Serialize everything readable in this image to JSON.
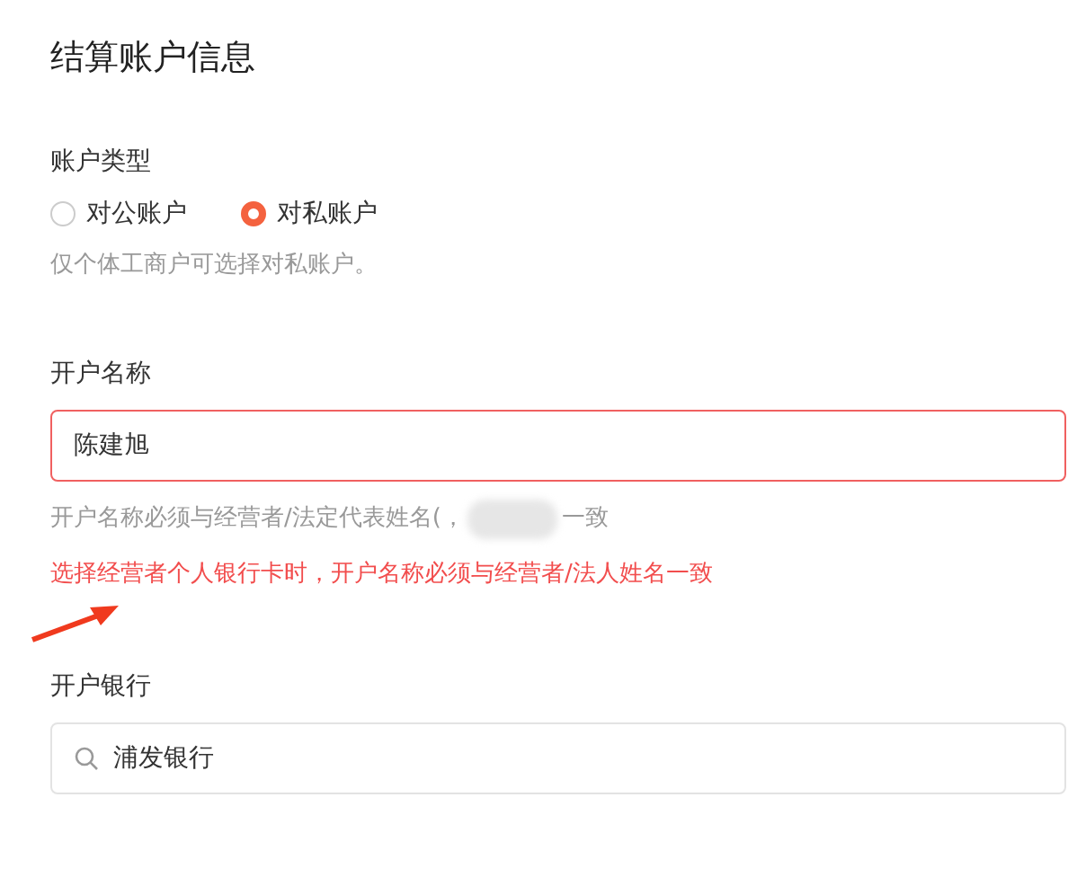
{
  "page_title": "结算账户信息",
  "account_type": {
    "label": "账户类型",
    "options": [
      {
        "label": "对公账户",
        "selected": false
      },
      {
        "label": "对私账户",
        "selected": true
      }
    ],
    "hint": "仅个体工商户可选择对私账户。"
  },
  "account_name": {
    "label": "开户名称",
    "value": "陈建旭",
    "error": true,
    "hint_before": "开户名称必须与经营者/法定代表姓名(，",
    "hint_after": "一致",
    "warning": "选择经营者个人银行卡时，开户名称必须与经营者/法人姓名一致"
  },
  "bank": {
    "label": "开户银行",
    "value": "浦发银行"
  }
}
